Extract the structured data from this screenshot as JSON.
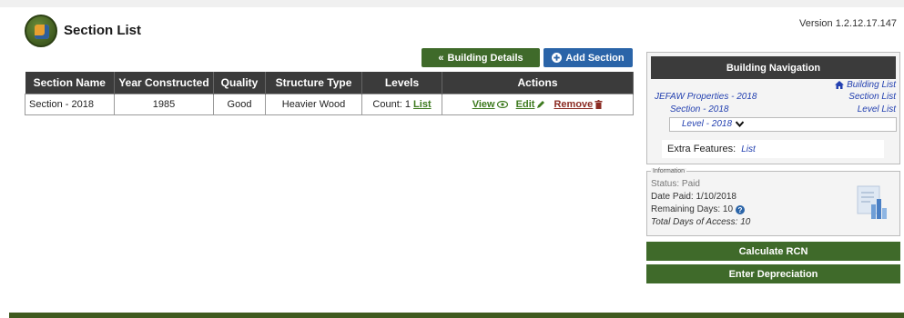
{
  "version": "Version 1.2.12.17.147",
  "page_title": "Section List",
  "buttons": {
    "building_details": "Building Details",
    "add_section": "Add Section"
  },
  "table": {
    "headers": [
      "Section Name",
      "Year Constructed",
      "Quality",
      "Structure Type",
      "Levels",
      "Actions"
    ],
    "rows": [
      {
        "section_name": "Section - 2018",
        "year": "1985",
        "quality": "Good",
        "structure": "Heavier Wood",
        "levels_count": "Count: 1",
        "levels_link": "List",
        "view": "View",
        "edit": "Edit",
        "remove": "Remove"
      }
    ]
  },
  "navigation": {
    "header": "Building Navigation",
    "building_list": "Building List",
    "section_list": "Section List",
    "level_list": "Level List",
    "property": "JEFAW Properties - 2018",
    "section": "Section - 2018",
    "level": "Level - 2018",
    "extra_label": "Extra Features:",
    "extra_link": "List"
  },
  "info": {
    "legend": "Information",
    "status": "Status: Paid",
    "date_paid": "Date Paid: 1/10/2018",
    "remaining": "Remaining Days: 10",
    "total": "Total Days of Access: 10"
  },
  "actions": {
    "calculate": "Calculate RCN",
    "depreciation": "Enter Depreciation"
  },
  "colors": {
    "accent_green": "#3f6a2a",
    "accent_blue": "#2a64a8",
    "header_dark": "#3b3b3b",
    "link_green": "#3d7a1e",
    "link_red": "#8b2b23",
    "link_blue": "#2340b0"
  }
}
